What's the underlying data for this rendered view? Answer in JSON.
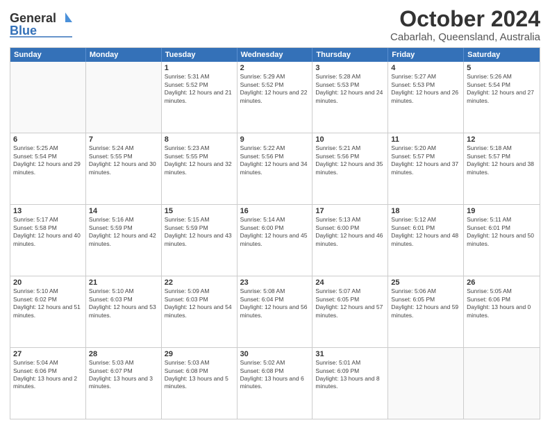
{
  "header": {
    "logo_line1": "General",
    "logo_line2": "Blue",
    "title": "October 2024",
    "subtitle": "Cabarlah, Queensland, Australia"
  },
  "days_of_week": [
    "Sunday",
    "Monday",
    "Tuesday",
    "Wednesday",
    "Thursday",
    "Friday",
    "Saturday"
  ],
  "weeks": [
    [
      {
        "day": "",
        "info": ""
      },
      {
        "day": "",
        "info": ""
      },
      {
        "day": "1",
        "info": "Sunrise: 5:31 AM\nSunset: 5:52 PM\nDaylight: 12 hours and 21 minutes."
      },
      {
        "day": "2",
        "info": "Sunrise: 5:29 AM\nSunset: 5:52 PM\nDaylight: 12 hours and 22 minutes."
      },
      {
        "day": "3",
        "info": "Sunrise: 5:28 AM\nSunset: 5:53 PM\nDaylight: 12 hours and 24 minutes."
      },
      {
        "day": "4",
        "info": "Sunrise: 5:27 AM\nSunset: 5:53 PM\nDaylight: 12 hours and 26 minutes."
      },
      {
        "day": "5",
        "info": "Sunrise: 5:26 AM\nSunset: 5:54 PM\nDaylight: 12 hours and 27 minutes."
      }
    ],
    [
      {
        "day": "6",
        "info": "Sunrise: 5:25 AM\nSunset: 5:54 PM\nDaylight: 12 hours and 29 minutes."
      },
      {
        "day": "7",
        "info": "Sunrise: 5:24 AM\nSunset: 5:55 PM\nDaylight: 12 hours and 30 minutes."
      },
      {
        "day": "8",
        "info": "Sunrise: 5:23 AM\nSunset: 5:55 PM\nDaylight: 12 hours and 32 minutes."
      },
      {
        "day": "9",
        "info": "Sunrise: 5:22 AM\nSunset: 5:56 PM\nDaylight: 12 hours and 34 minutes."
      },
      {
        "day": "10",
        "info": "Sunrise: 5:21 AM\nSunset: 5:56 PM\nDaylight: 12 hours and 35 minutes."
      },
      {
        "day": "11",
        "info": "Sunrise: 5:20 AM\nSunset: 5:57 PM\nDaylight: 12 hours and 37 minutes."
      },
      {
        "day": "12",
        "info": "Sunrise: 5:18 AM\nSunset: 5:57 PM\nDaylight: 12 hours and 38 minutes."
      }
    ],
    [
      {
        "day": "13",
        "info": "Sunrise: 5:17 AM\nSunset: 5:58 PM\nDaylight: 12 hours and 40 minutes."
      },
      {
        "day": "14",
        "info": "Sunrise: 5:16 AM\nSunset: 5:59 PM\nDaylight: 12 hours and 42 minutes."
      },
      {
        "day": "15",
        "info": "Sunrise: 5:15 AM\nSunset: 5:59 PM\nDaylight: 12 hours and 43 minutes."
      },
      {
        "day": "16",
        "info": "Sunrise: 5:14 AM\nSunset: 6:00 PM\nDaylight: 12 hours and 45 minutes."
      },
      {
        "day": "17",
        "info": "Sunrise: 5:13 AM\nSunset: 6:00 PM\nDaylight: 12 hours and 46 minutes."
      },
      {
        "day": "18",
        "info": "Sunrise: 5:12 AM\nSunset: 6:01 PM\nDaylight: 12 hours and 48 minutes."
      },
      {
        "day": "19",
        "info": "Sunrise: 5:11 AM\nSunset: 6:01 PM\nDaylight: 12 hours and 50 minutes."
      }
    ],
    [
      {
        "day": "20",
        "info": "Sunrise: 5:10 AM\nSunset: 6:02 PM\nDaylight: 12 hours and 51 minutes."
      },
      {
        "day": "21",
        "info": "Sunrise: 5:10 AM\nSunset: 6:03 PM\nDaylight: 12 hours and 53 minutes."
      },
      {
        "day": "22",
        "info": "Sunrise: 5:09 AM\nSunset: 6:03 PM\nDaylight: 12 hours and 54 minutes."
      },
      {
        "day": "23",
        "info": "Sunrise: 5:08 AM\nSunset: 6:04 PM\nDaylight: 12 hours and 56 minutes."
      },
      {
        "day": "24",
        "info": "Sunrise: 5:07 AM\nSunset: 6:05 PM\nDaylight: 12 hours and 57 minutes."
      },
      {
        "day": "25",
        "info": "Sunrise: 5:06 AM\nSunset: 6:05 PM\nDaylight: 12 hours and 59 minutes."
      },
      {
        "day": "26",
        "info": "Sunrise: 5:05 AM\nSunset: 6:06 PM\nDaylight: 13 hours and 0 minutes."
      }
    ],
    [
      {
        "day": "27",
        "info": "Sunrise: 5:04 AM\nSunset: 6:06 PM\nDaylight: 13 hours and 2 minutes."
      },
      {
        "day": "28",
        "info": "Sunrise: 5:03 AM\nSunset: 6:07 PM\nDaylight: 13 hours and 3 minutes."
      },
      {
        "day": "29",
        "info": "Sunrise: 5:03 AM\nSunset: 6:08 PM\nDaylight: 13 hours and 5 minutes."
      },
      {
        "day": "30",
        "info": "Sunrise: 5:02 AM\nSunset: 6:08 PM\nDaylight: 13 hours and 6 minutes."
      },
      {
        "day": "31",
        "info": "Sunrise: 5:01 AM\nSunset: 6:09 PM\nDaylight: 13 hours and 8 minutes."
      },
      {
        "day": "",
        "info": ""
      },
      {
        "day": "",
        "info": ""
      }
    ]
  ]
}
